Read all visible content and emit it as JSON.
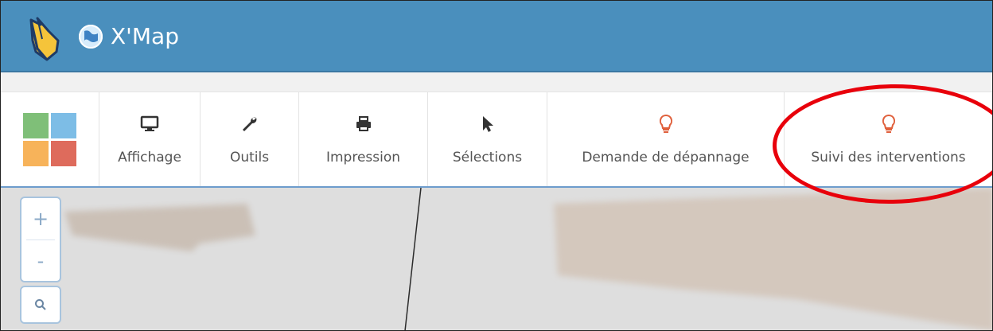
{
  "app": {
    "title": "X'Map"
  },
  "toolbar": {
    "items": [
      {
        "label": "Affichage",
        "icon": "monitor-icon"
      },
      {
        "label": "Outils",
        "icon": "wrench-icon"
      },
      {
        "label": "Impression",
        "icon": "printer-icon"
      },
      {
        "label": "Sélections",
        "icon": "cursor-icon"
      },
      {
        "label": "Demande de dépannage",
        "icon": "lightbulb-icon"
      },
      {
        "label": "Suivi des interventions",
        "icon": "lightbulb-icon"
      }
    ]
  },
  "map_controls": {
    "zoom_in": "+",
    "zoom_out": "-",
    "search_icon": "search-icon"
  },
  "colors": {
    "header": "#4a8fbd",
    "accent": "#6d9ccc",
    "highlight": "#e8000b",
    "bulb": "#e0603c"
  }
}
